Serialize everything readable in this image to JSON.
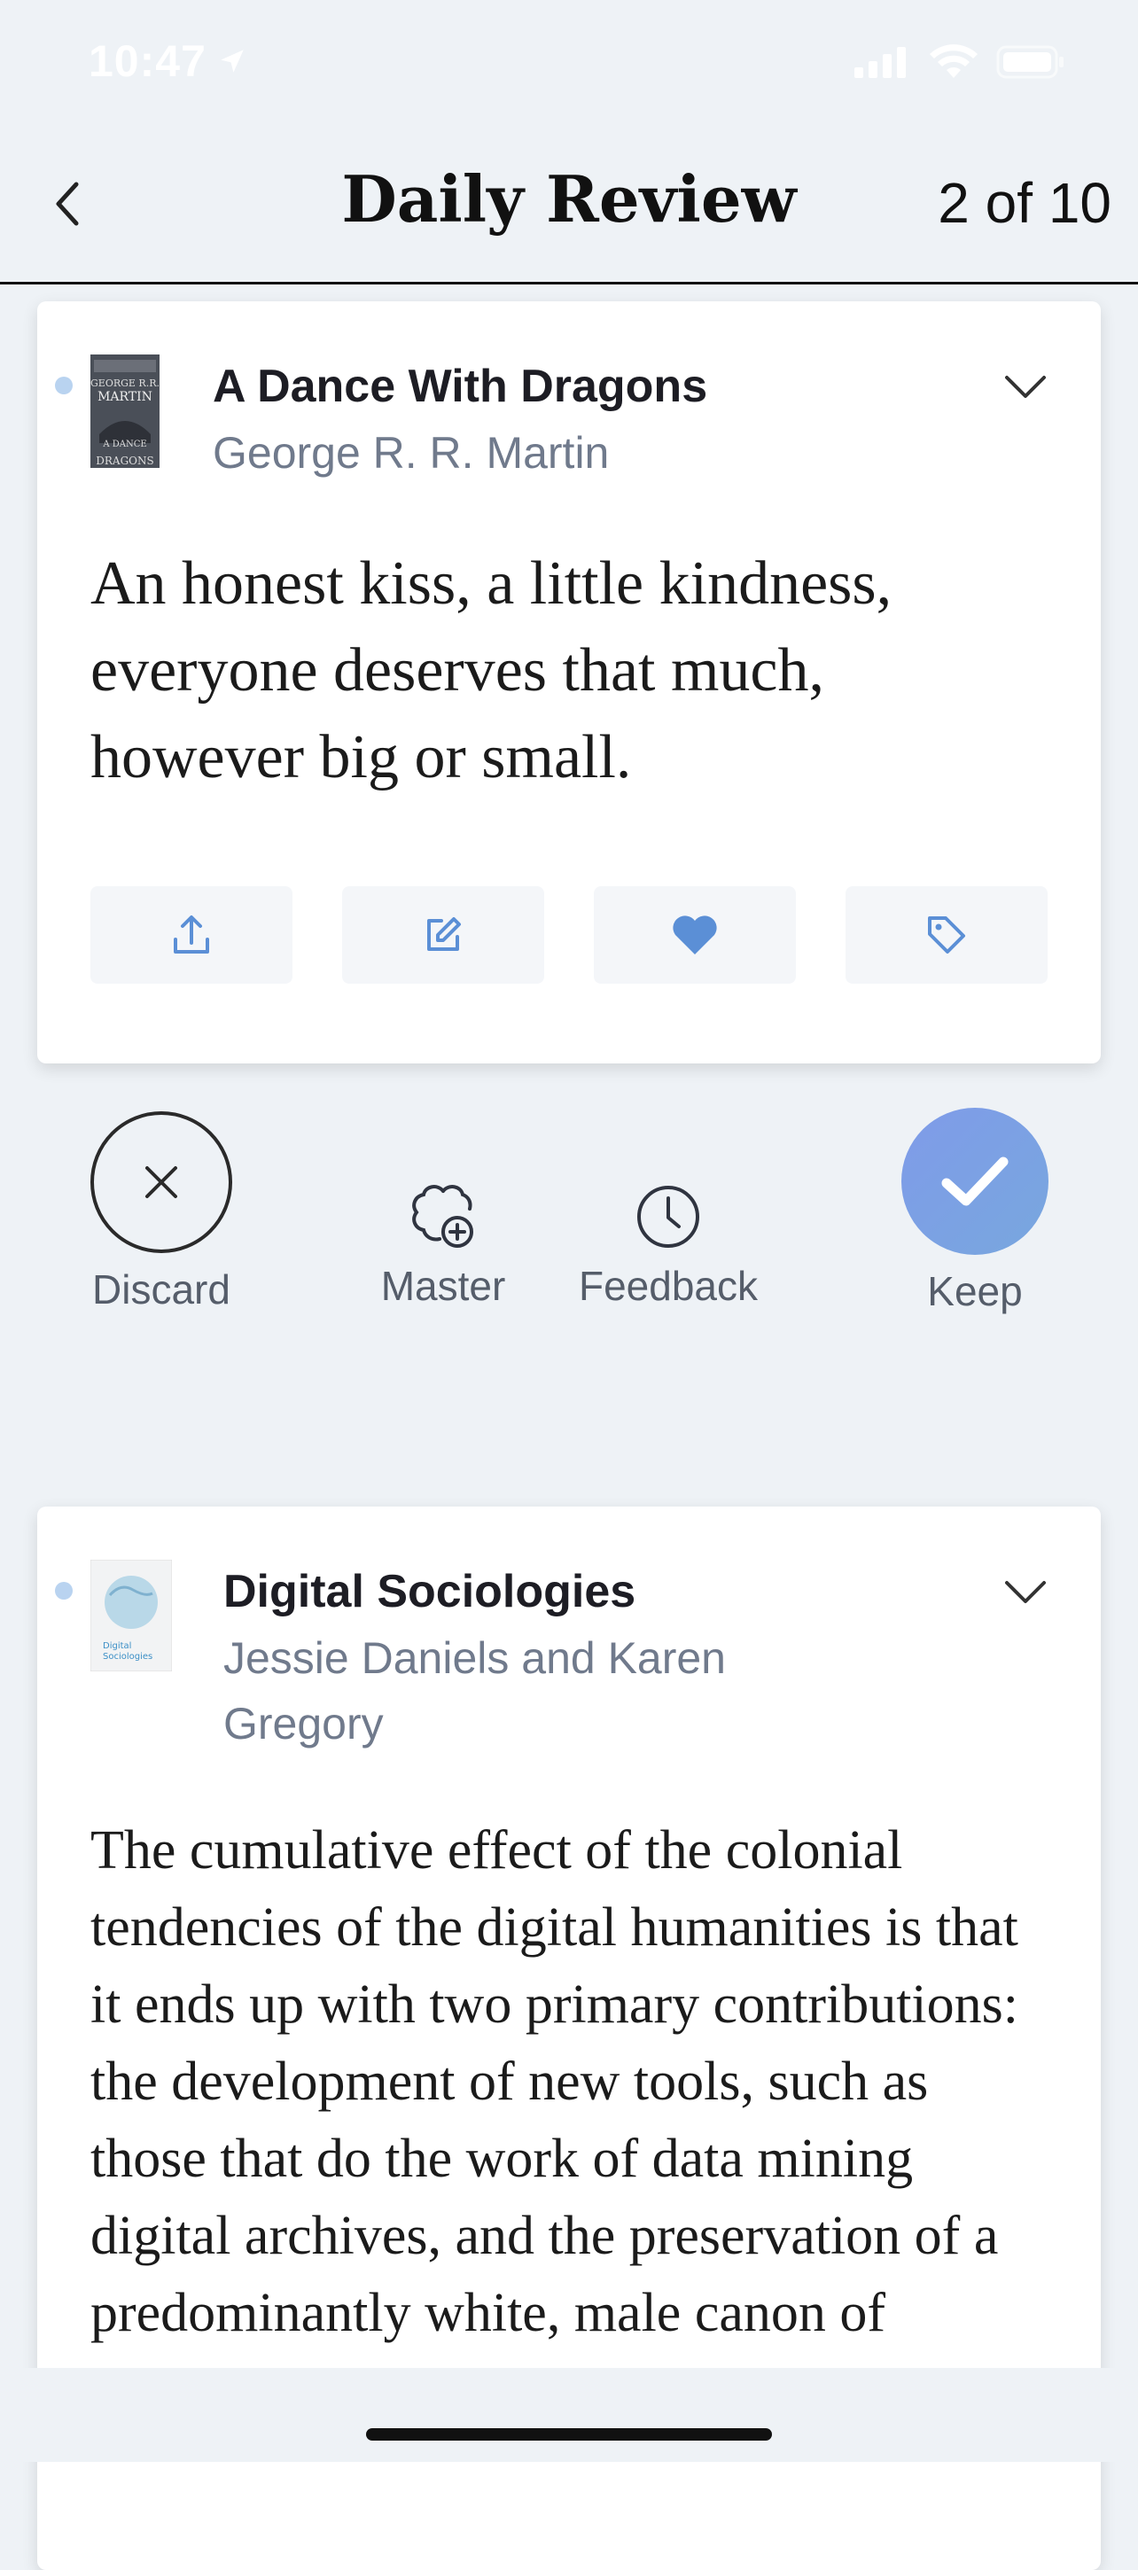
{
  "status_bar": {
    "time": "10:47"
  },
  "header": {
    "title": "Daily Review",
    "counter": "2 of 10"
  },
  "cards": [
    {
      "book_title": "A Dance With Dragons",
      "author": "George R. R. Martin",
      "quote": "An honest kiss, a little kindness, everyone deserves that much, however big or small.",
      "cover_text": [
        "GEORGE R.R.",
        "MARTIN",
        "A DANCE",
        "WITH",
        "DRAGONS"
      ],
      "actions": [
        "share-icon",
        "edit-icon",
        "heart-icon",
        "tag-icon"
      ]
    },
    {
      "book_title": "Digital Sociologies",
      "author": "Jessie Daniels and Karen Gregory",
      "quote": "The cumulative effect of the colonial tendencies of the digital humanities is that it ends up with two primary contributions: the development of new tools, such as those that do the work of data mining digital archives, and the preservation of a predominantly white, male canon of literature. Overly",
      "cover_text": [
        "Digital",
        "Sociologies"
      ]
    }
  ],
  "controls": {
    "discard": "Discard",
    "master": "Master",
    "feedback": "Feedback",
    "keep": "Keep"
  },
  "colors": {
    "accent": "#7f9be9",
    "background": "#eef2f6",
    "author_gray": "#707a8c",
    "icon_blue": "#5b8fd6"
  }
}
